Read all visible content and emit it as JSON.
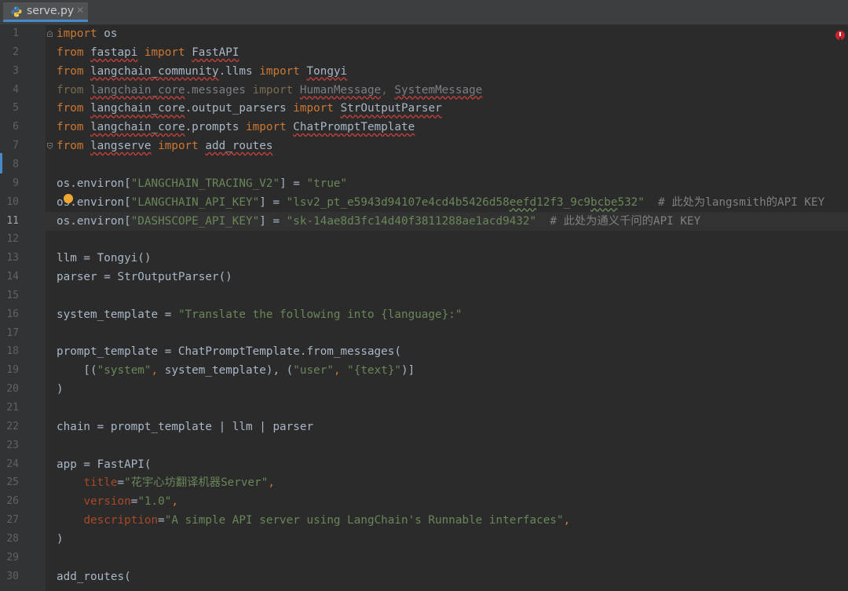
{
  "tab": {
    "filename": "serve.py",
    "close_glyph": "✕"
  },
  "line_numbers": [
    "1",
    "2",
    "3",
    "4",
    "5",
    "6",
    "7",
    "8",
    "9",
    "10",
    "11",
    "12",
    "13",
    "14",
    "15",
    "16",
    "17",
    "18",
    "19",
    "20",
    "21",
    "22",
    "23",
    "24",
    "25",
    "26",
    "27",
    "28",
    "29",
    "30"
  ],
  "current_line": 11,
  "code_lines": [
    [
      {
        "t": "import",
        "c": "kw"
      },
      {
        "t": " os"
      }
    ],
    [
      {
        "t": "from",
        "c": "kw"
      },
      {
        "t": " "
      },
      {
        "t": "fastapi",
        "c": "warn"
      },
      {
        "t": " "
      },
      {
        "t": "import",
        "c": "kw"
      },
      {
        "t": " "
      },
      {
        "t": "FastAPI",
        "c": "warn"
      }
    ],
    [
      {
        "t": "from",
        "c": "kw"
      },
      {
        "t": " "
      },
      {
        "t": "langchain_community",
        "c": "warn"
      },
      {
        "t": ".llms "
      },
      {
        "t": "import",
        "c": "kw"
      },
      {
        "t": " "
      },
      {
        "t": "Tongyi",
        "c": "warn"
      }
    ],
    [
      {
        "t": "from",
        "c": "dimkw"
      },
      {
        "t": " ",
        "c": "dim"
      },
      {
        "t": "langchain_core",
        "c": "dim warn"
      },
      {
        "t": ".messages ",
        "c": "dim"
      },
      {
        "t": "import",
        "c": "dimkw"
      },
      {
        "t": " ",
        "c": "dim"
      },
      {
        "t": "HumanMessage",
        "c": "dim warn"
      },
      {
        "t": ", ",
        "c": "dimkw"
      },
      {
        "t": "SystemMessage",
        "c": "dim warn"
      }
    ],
    [
      {
        "t": "from",
        "c": "kw"
      },
      {
        "t": " "
      },
      {
        "t": "langchain_core",
        "c": "warn"
      },
      {
        "t": ".output_parsers "
      },
      {
        "t": "import",
        "c": "kw"
      },
      {
        "t": " "
      },
      {
        "t": "StrOutputParser",
        "c": "warn"
      }
    ],
    [
      {
        "t": "from",
        "c": "kw"
      },
      {
        "t": " "
      },
      {
        "t": "langchain_core",
        "c": "warn"
      },
      {
        "t": ".prompts "
      },
      {
        "t": "import",
        "c": "kw"
      },
      {
        "t": " "
      },
      {
        "t": "ChatPromptTemplate",
        "c": "warn"
      }
    ],
    [
      {
        "t": "from",
        "c": "kw"
      },
      {
        "t": " "
      },
      {
        "t": "langserve",
        "c": "warn"
      },
      {
        "t": " "
      },
      {
        "t": "import",
        "c": "kw"
      },
      {
        "t": " "
      },
      {
        "t": "add_routes",
        "c": "warn"
      }
    ],
    [],
    [
      {
        "t": "os.environ["
      },
      {
        "t": "\"LANGCHAIN_TRACING_V2\"",
        "c": "str"
      },
      {
        "t": "] = "
      },
      {
        "t": "\"true\"",
        "c": "str"
      }
    ],
    [
      {
        "t": "os.environ["
      },
      {
        "t": "\"LANGCHAIN_API_KEY\"",
        "c": "str"
      },
      {
        "t": "] = "
      },
      {
        "t": "\"lsv2_pt_e5943d94107e4cd4b5426d58",
        "c": "str"
      },
      {
        "t": "eefd",
        "c": "str typo"
      },
      {
        "t": "12f3_9c9",
        "c": "str"
      },
      {
        "t": "bcbe",
        "c": "str typo"
      },
      {
        "t": "532\"",
        "c": "str"
      },
      {
        "t": "  # 此处为langsmith的API KEY",
        "c": "cmt"
      }
    ],
    [
      {
        "t": "os.environ["
      },
      {
        "t": "\"DASHSCOPE_API_KEY\"",
        "c": "str"
      },
      {
        "t": "] = "
      },
      {
        "t": "\"sk-14ae8d3fc14d40f3811288ae1acd9432\"",
        "c": "str"
      },
      {
        "t": "  # 此处为通义千问的API KEY",
        "c": "cmt"
      }
    ],
    [],
    [
      {
        "t": "llm = Tongyi()"
      }
    ],
    [
      {
        "t": "parser = StrOutputParser()"
      }
    ],
    [],
    [
      {
        "t": "system_template = "
      },
      {
        "t": "\"Translate the following into {language}:\"",
        "c": "str"
      }
    ],
    [],
    [
      {
        "t": "prompt_template = ChatPromptTemplate.from_messages("
      }
    ],
    [
      {
        "t": "    [("
      },
      {
        "t": "\"system\"",
        "c": "str"
      },
      {
        "t": ", ",
        "c": "kw"
      },
      {
        "t": "system_template), ("
      },
      {
        "t": "\"user\"",
        "c": "str"
      },
      {
        "t": ", ",
        "c": "kw"
      },
      {
        "t": "\"{text}\"",
        "c": "str"
      },
      {
        "t": ")]"
      }
    ],
    [
      {
        "t": ")"
      }
    ],
    [],
    [
      {
        "t": "chain = prompt_template | llm | parser"
      }
    ],
    [],
    [
      {
        "t": "app = FastAPI("
      }
    ],
    [
      {
        "t": "    "
      },
      {
        "t": "title",
        "c": "param"
      },
      {
        "t": "="
      },
      {
        "t": "\"花宇心坊翻译机器Server\"",
        "c": "str"
      },
      {
        "t": ",",
        "c": "kw"
      }
    ],
    [
      {
        "t": "    "
      },
      {
        "t": "version",
        "c": "param"
      },
      {
        "t": "="
      },
      {
        "t": "\"1.0\"",
        "c": "str"
      },
      {
        "t": ",",
        "c": "kw"
      }
    ],
    [
      {
        "t": "    "
      },
      {
        "t": "description",
        "c": "param"
      },
      {
        "t": "="
      },
      {
        "t": "\"A simple API server using LangChain's Runnable interfaces\"",
        "c": "str"
      },
      {
        "t": ",",
        "c": "kw"
      }
    ],
    [
      {
        "t": ")"
      }
    ],
    [],
    [
      {
        "t": "add_routes("
      }
    ]
  ]
}
